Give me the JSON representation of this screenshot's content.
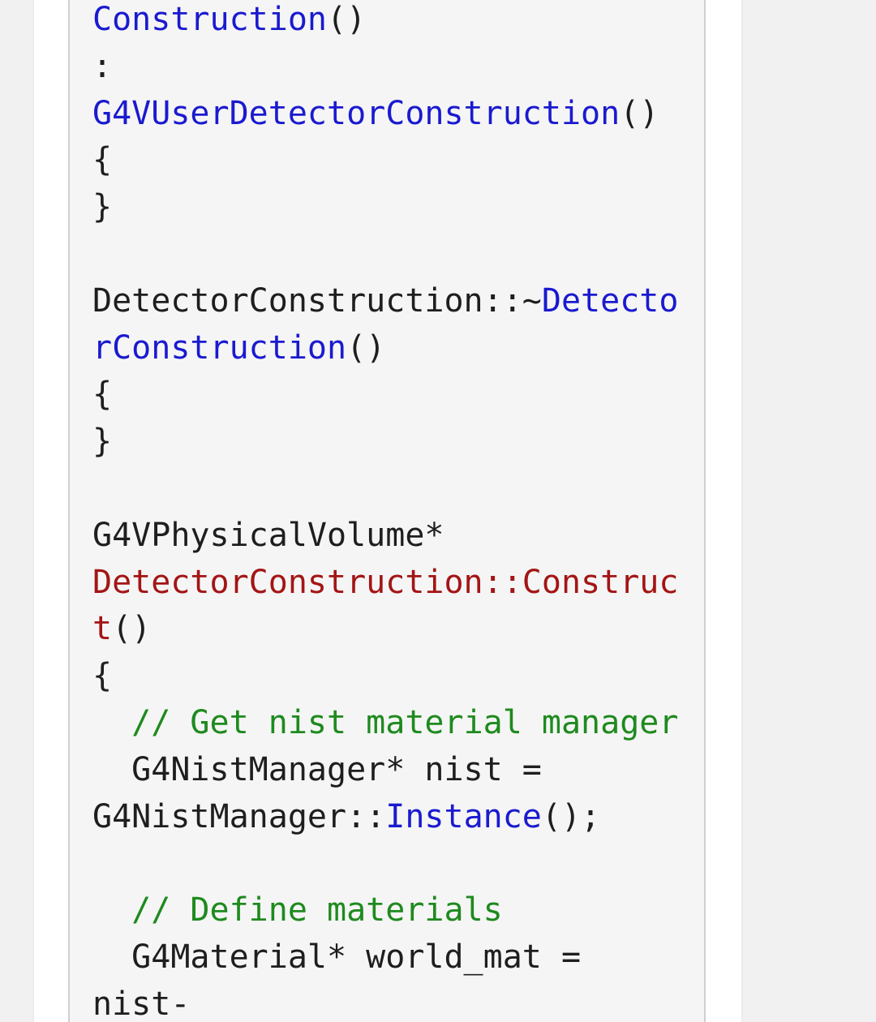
{
  "code_lines": [
    [
      {
        "t": "Construction",
        "c": "fn"
      },
      {
        "t": "()",
        "c": "pl"
      }
    ],
    [
      {
        "t": ":",
        "c": "pl"
      }
    ],
    [
      {
        "t": "G4VUserDetectorConstruction",
        "c": "fn"
      },
      {
        "t": "()",
        "c": "pl"
      }
    ],
    [
      {
        "t": "{",
        "c": "pl"
      }
    ],
    [
      {
        "t": "}",
        "c": "pl"
      }
    ],
    [],
    [
      {
        "t": "DetectorConstruction::~",
        "c": "pl"
      },
      {
        "t": "Detecto",
        "c": "fn"
      }
    ],
    [
      {
        "t": "rConstruction",
        "c": "fn"
      },
      {
        "t": "()",
        "c": "pl"
      }
    ],
    [
      {
        "t": "{",
        "c": "pl"
      }
    ],
    [
      {
        "t": "}",
        "c": "pl"
      }
    ],
    [],
    [
      {
        "t": "G4VPhysicalVolume*",
        "c": "pl"
      }
    ],
    [
      {
        "t": "DetectorConstruction::Construc",
        "c": "def"
      }
    ],
    [
      {
        "t": "t",
        "c": "def"
      },
      {
        "t": "()",
        "c": "pl"
      }
    ],
    [
      {
        "t": "{",
        "c": "pl"
      }
    ],
    [
      {
        "t": "  ",
        "c": "pl"
      },
      {
        "t": "// Get nist material manager",
        "c": "cm"
      }
    ],
    [
      {
        "t": "  G4NistManager* nist =",
        "c": "pl"
      }
    ],
    [
      {
        "t": "G4NistManager::",
        "c": "pl"
      },
      {
        "t": "Instance",
        "c": "fn"
      },
      {
        "t": "();",
        "c": "pl"
      }
    ],
    [],
    [
      {
        "t": "  ",
        "c": "pl"
      },
      {
        "t": "// Define materials",
        "c": "cm"
      }
    ],
    [
      {
        "t": "  G4Material* world_mat =",
        "c": "pl"
      }
    ],
    [
      {
        "t": "nist-",
        "c": "pl"
      }
    ]
  ],
  "colors": {
    "page_background": "#f1f1f1",
    "card_background": "#ffffff",
    "code_background": "#f5f5f5",
    "function_name": "#1a1ad0",
    "definition_name": "#a31515",
    "comment": "#1e8a1e",
    "plain_text": "#1e1e1e"
  }
}
